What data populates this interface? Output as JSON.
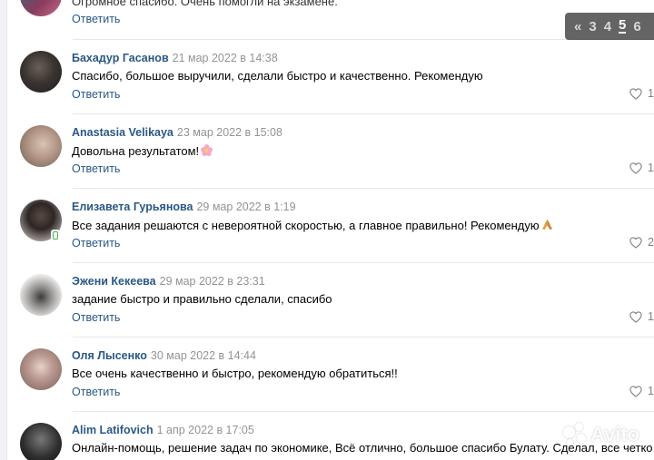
{
  "pager": {
    "prev": "«",
    "pages": [
      "3",
      "4",
      "5",
      "6"
    ],
    "current": "5"
  },
  "top_comment": {
    "text": "Огромное спасибо. Очень помогли на экзамене.",
    "reply": "Ответить"
  },
  "comments": [
    {
      "author": "Бахадур Гасанов",
      "date": "21 мар 2022 в 14:38",
      "text": "Спасибо, большое выручили, сделали быстро и качественно. Рекомендую",
      "reply": "Ответить",
      "likes": "1"
    },
    {
      "author": "Anastasia Velikaya",
      "date": "23 мар 2022 в 15:08",
      "text": "Довольна результатом!",
      "emoji": "flower",
      "reply": "Ответить",
      "likes": "1"
    },
    {
      "author": "Елизавета Гурьянова",
      "date": "29 мар 2022 в 1:19",
      "text": "Все задания решаются с невероятной скоростью, а главное правильно! Рекомендую",
      "emoji": "folded-hands",
      "reply": "Ответить",
      "likes": "2"
    },
    {
      "author": "Эжени Кекеева",
      "date": "29 мар 2022 в 23:31",
      "text": "задание быстро и правильно сделали, спасибо",
      "reply": "Ответить",
      "likes": "1"
    },
    {
      "author": "Оля Лысенко",
      "date": "30 мар 2022 в 14:44",
      "text": "Все очень качественно и быстро, рекомендую обратиться!!",
      "reply": "Ответить",
      "likes": "1"
    },
    {
      "author": "Alim Latifovich",
      "date": "1 апр 2022 в 17:05",
      "text": "Онлайн-помощь, решение задач по экономике, Всё отлично, большое спасибо Булату. Сделал, все четко и"
    }
  ],
  "watermark": "Avito",
  "colors": {
    "link": "#2a5885",
    "date": "#939393",
    "divider": "#e7e8ec",
    "like": "#828282"
  }
}
